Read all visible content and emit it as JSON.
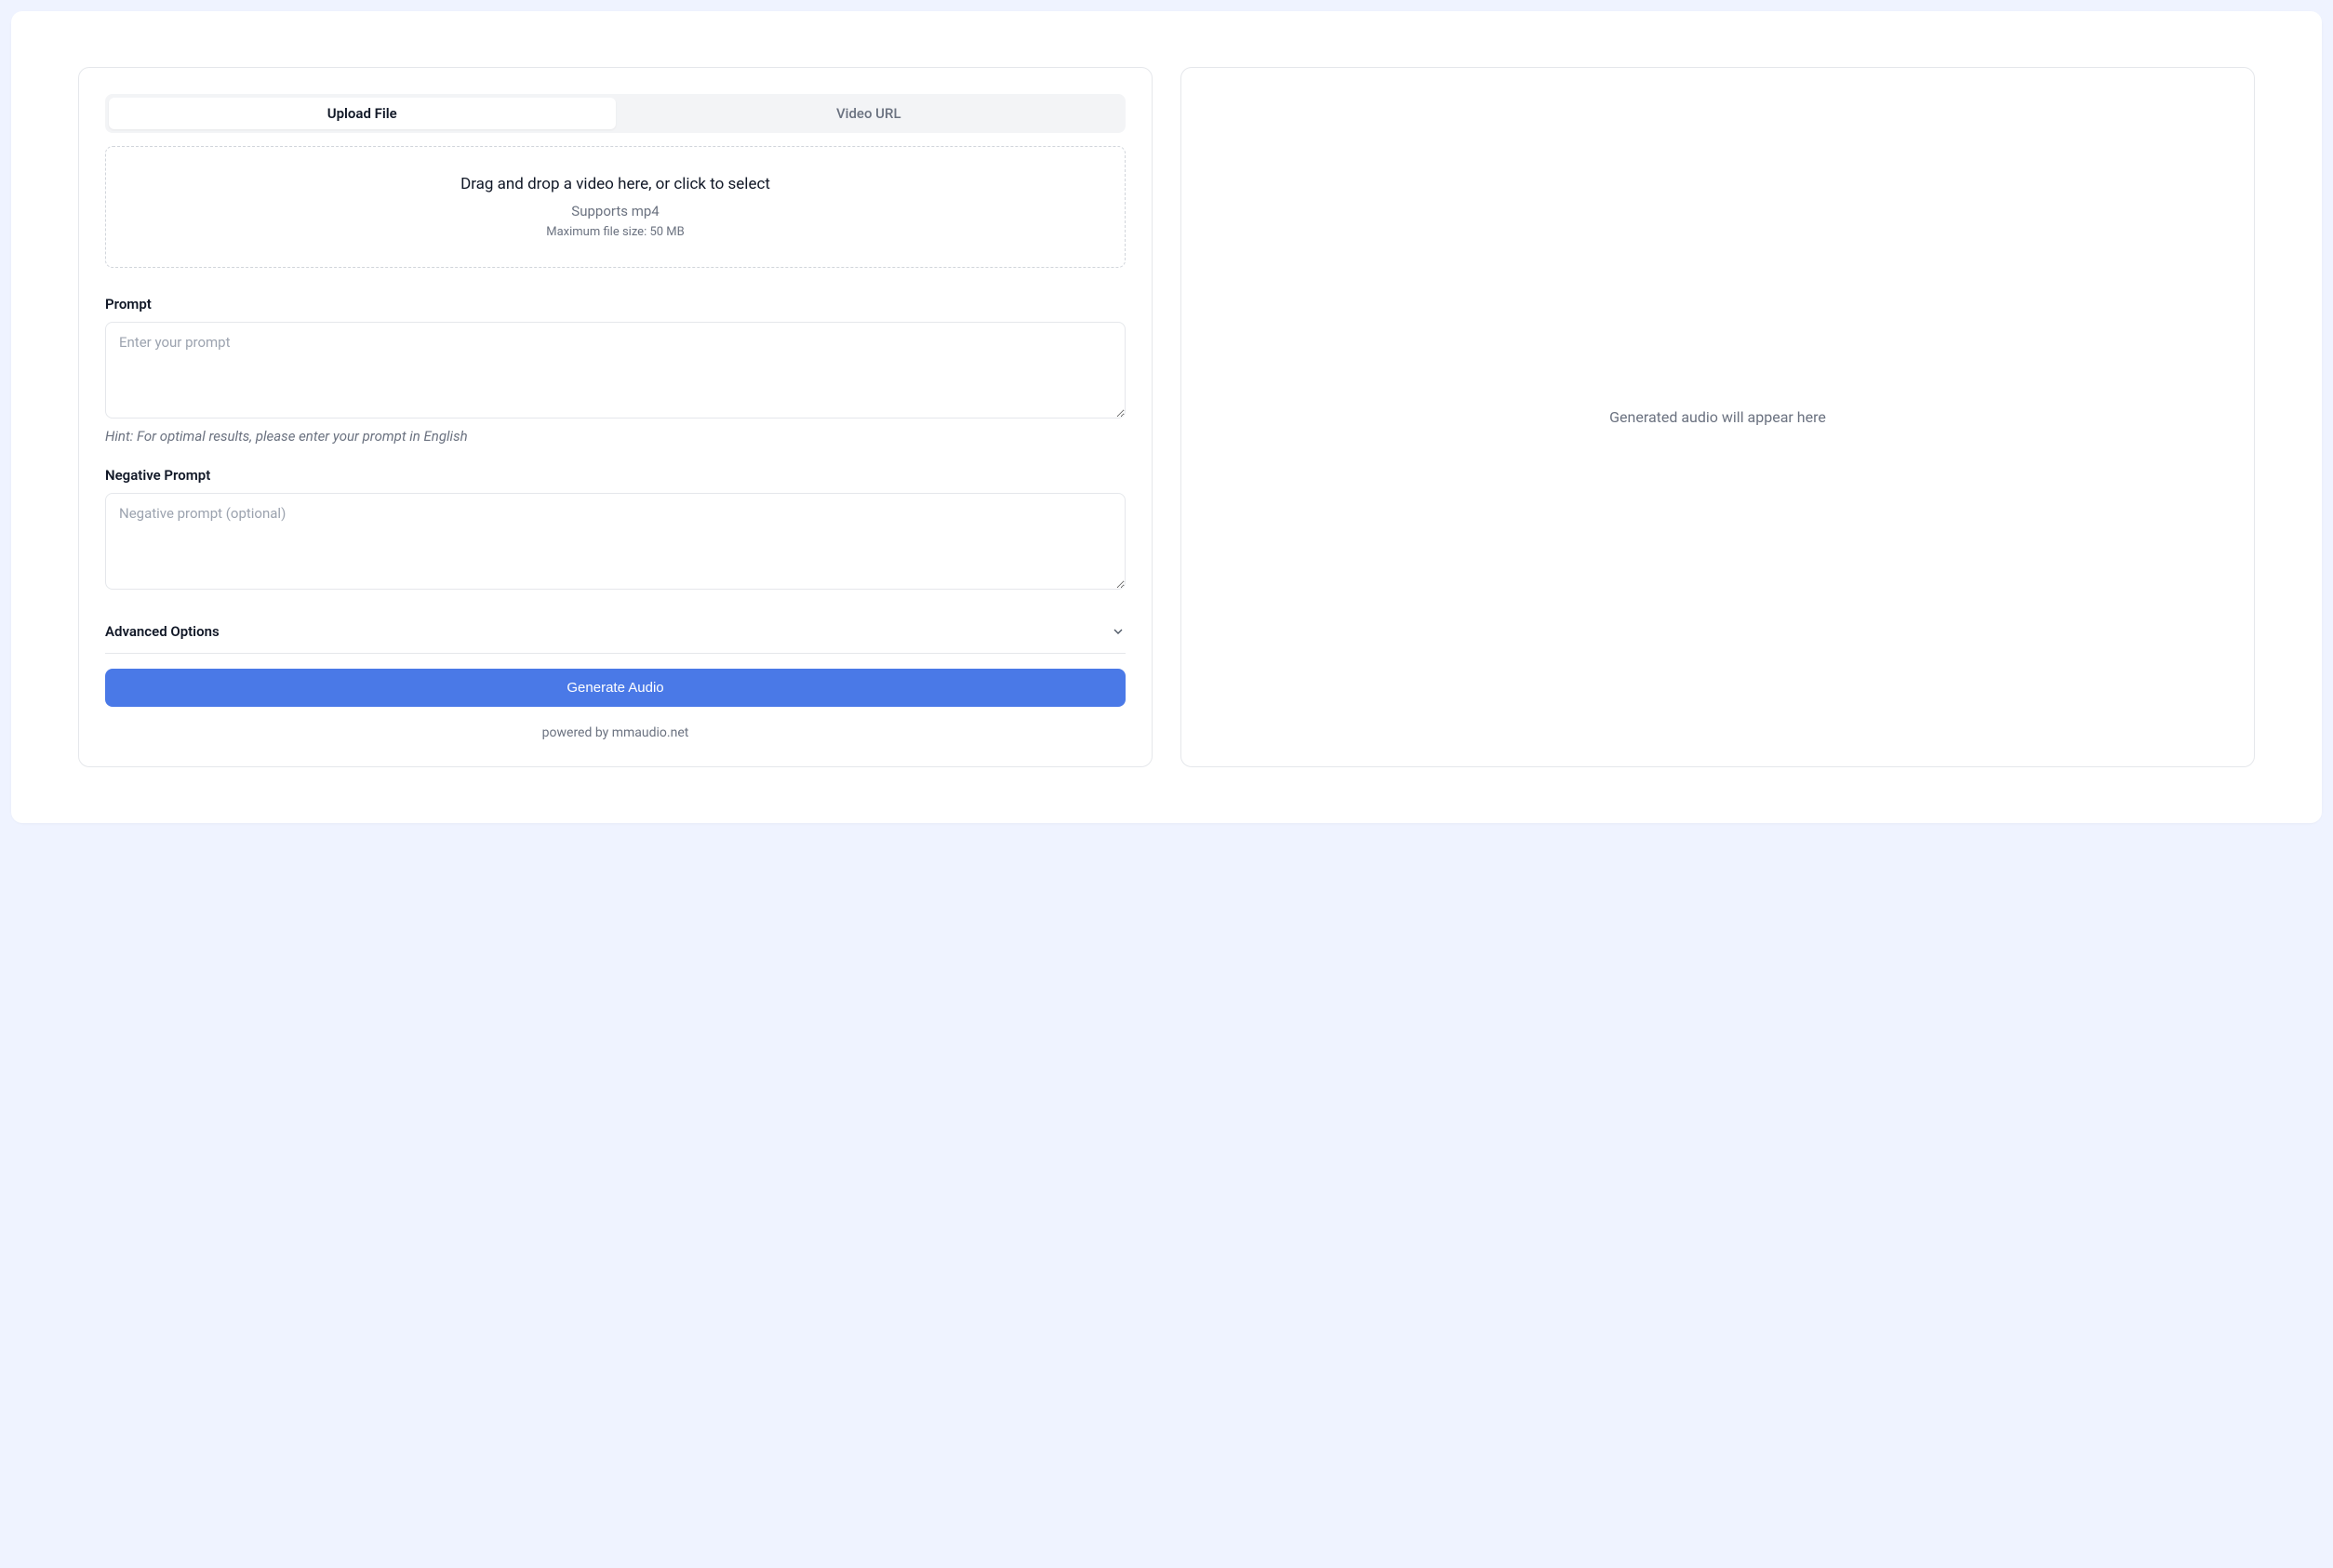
{
  "tabs": {
    "upload": "Upload File",
    "url": "Video URL"
  },
  "dropzone": {
    "title": "Drag and drop a video here, or click to select",
    "supports": "Supports mp4",
    "maxsize": "Maximum file size: 50 MB"
  },
  "prompt": {
    "label": "Prompt",
    "placeholder": "Enter your prompt",
    "hint": "Hint: For optimal results, please enter your prompt in English"
  },
  "negative": {
    "label": "Negative Prompt",
    "placeholder": "Negative prompt (optional)"
  },
  "advanced": {
    "label": "Advanced Options"
  },
  "generate": {
    "label": "Generate Audio"
  },
  "powered": "powered by mmaudio.net",
  "output": {
    "placeholder": "Generated audio will appear here"
  }
}
